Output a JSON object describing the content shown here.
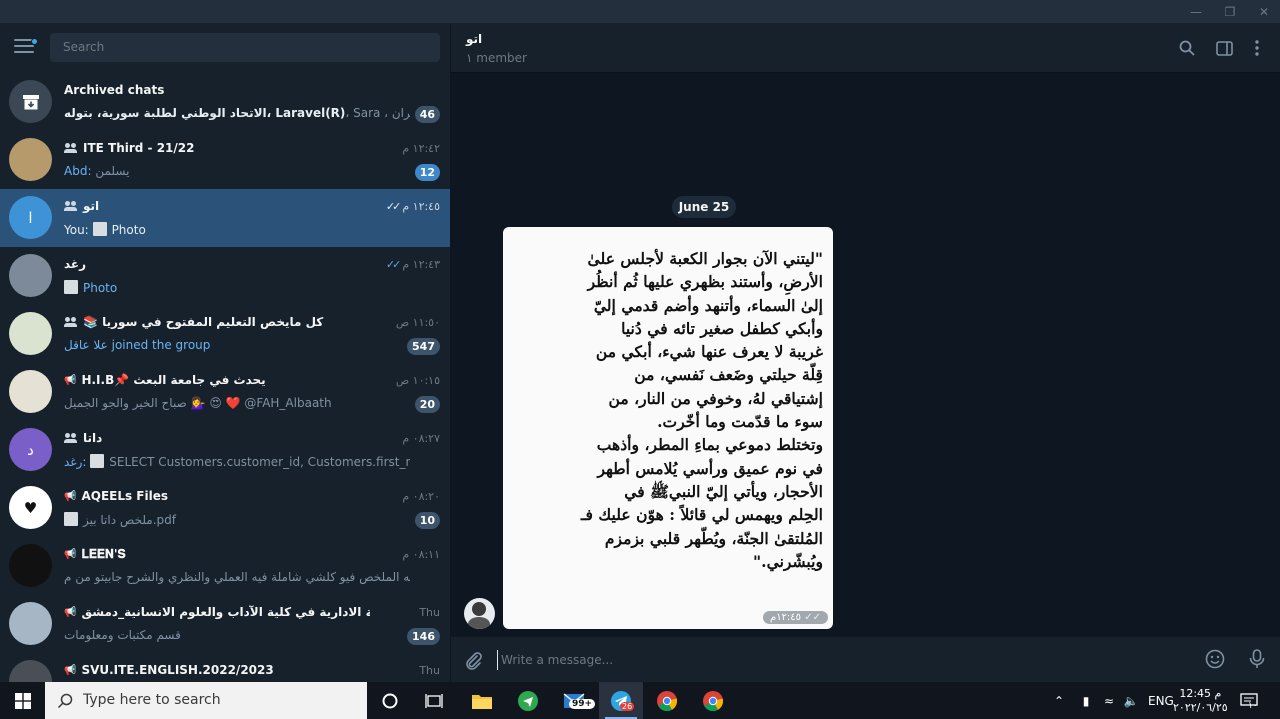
{
  "search": {
    "placeholder": "Search"
  },
  "chats": [
    {
      "title": "Archived chats",
      "preview_bold": "الاتحاد الوطني لطلبة سورية، بتوله، Laravel(R)",
      "preview": "، Sara ، بنيان ٢ -، أم عمران…",
      "badge": "46",
      "badge_style": "muted",
      "avatar_text": "",
      "avatar_color": "#3b4755",
      "kind": "archive"
    },
    {
      "title": "ITE Third - 21/22",
      "preview_sender": "Abd:",
      "preview": "يسلمن",
      "time": "١٢:٤٢ م",
      "badge": "12",
      "badge_style": "blue",
      "avatar_text": "",
      "avatar_color": "#b79a6b",
      "kind": "group"
    },
    {
      "title": "اتو",
      "preview_sender": "You:",
      "preview": "Photo",
      "time": "١٢:٤٥ م",
      "avatar_text": "ا",
      "avatar_color": "#3e93d6",
      "kind": "group",
      "selected": true,
      "ticks": "✓✓"
    },
    {
      "title": "رغد",
      "preview": "Photo",
      "time": "١٢:٤٣ م",
      "avatar_text": "",
      "avatar_color": "#7d8a9a",
      "kind": "user",
      "ticks": "✓✓"
    },
    {
      "title": "📚 كل مايخص التعليم المفتوح في سوريا",
      "preview_sender": "علا عاقل",
      "preview": "joined the group",
      "time": "١١:٥٠ ص",
      "badge": "547",
      "badge_style": "muted",
      "avatar_text": "",
      "avatar_color": "#d9e3d0",
      "kind": "group"
    },
    {
      "title": "H.I.B📌 يحدث في جامعة البعث",
      "preview": "صباح الخير والجو الجميل 💁‍♀️ 😍 ❤️ @FAH_Albaath",
      "time": "١٠:١٥ ص",
      "badge": "20",
      "badge_style": "muted",
      "avatar_text": "",
      "avatar_color": "#e6e1d5",
      "kind": "channel"
    },
    {
      "title": "داتا",
      "preview_sender": "رغد:",
      "preview": "SELECT Customers.customer_id, Customers.first_name, Or...",
      "time": "٠٨:٢٧ م",
      "avatar_text": "د",
      "avatar_color": "#7b5fc9",
      "kind": "group"
    },
    {
      "title": "AQEELs Files",
      "preview": "ملخص داتا بيز.pdf",
      "time": "٠٨:٢٠ م",
      "badge": "10",
      "badge_style": "muted",
      "avatar_text": "♥",
      "avatar_color": "#ffffff",
      "kind": "channel"
    },
    {
      "title": "𝐋𝐄𝐄𝐍'𝐒",
      "preview": "أن شاء الله الملخص فيو كلشي شاملة فيه العملي والنظري والشرح جابيتو من م…",
      "time": "٠٨:١١ م",
      "avatar_text": "",
      "avatar_color": "#111111",
      "kind": "channel"
    },
    {
      "title": "الهيئة الادارية في كلية الآداب والعلوم الانسانية_دمشق",
      "preview": "قسم مكتبات ومعلومات",
      "time": "Thu",
      "badge": "146",
      "badge_style": "muted",
      "avatar_text": "",
      "avatar_color": "#a7b6c4",
      "kind": "channel"
    },
    {
      "title": "SVU.ITE.ENGLISH.2022/2023",
      "preview": "",
      "time": "Thu",
      "avatar_text": "",
      "avatar_color": "#4a4f57",
      "kind": "channel"
    }
  ],
  "header": {
    "title": "اتو",
    "subtitle": "١ member"
  },
  "date_separator": "June 25",
  "message": {
    "photo_text_lines": [
      "\"ليتني الآن بجوار الكعبة لأجلس علىٰ",
      "الأرضِ، وأستند بظهري عليها ثُم أنظُر",
      "إلىٰ السماء، وأتنهد وأضم قدمي إليّ",
      "وأبكي كطفل صغير تائه في دُنيا",
      "غريبة لا يعرف عنها شيء، أبكي من",
      "قِلّة حيلتي وضَعف نَفسي، من",
      "إشتياقي لهُ، وخوفي من النار، من",
      "سوء ما قدّمت وما أخّرت.",
      "وتختلط دموعي بماءِ المطر، وأذهب",
      "في نوم عميق ورأسي يُلامس أطهر",
      "الأحجار، ويأتي إليّ النبيﷺ في",
      "الحِلم ويهمس لي قائلاً : هوّن عليك فـ",
      "المُلتقىٰ الجنّة، ويُطّهر قلبي بزمزم",
      "ويُبشّرني.\""
    ],
    "time": "١٢:٤٥م"
  },
  "composer": {
    "placeholder": "Write a message..."
  },
  "taskbar": {
    "search_placeholder": "Type here to search",
    "mail_badge": "99+",
    "telegram_badge": "26",
    "lang": "ENG",
    "time": "12:45 م",
    "date": "٢٠٢٢/٠٦/٢٥",
    "notif_count": "١٠"
  }
}
